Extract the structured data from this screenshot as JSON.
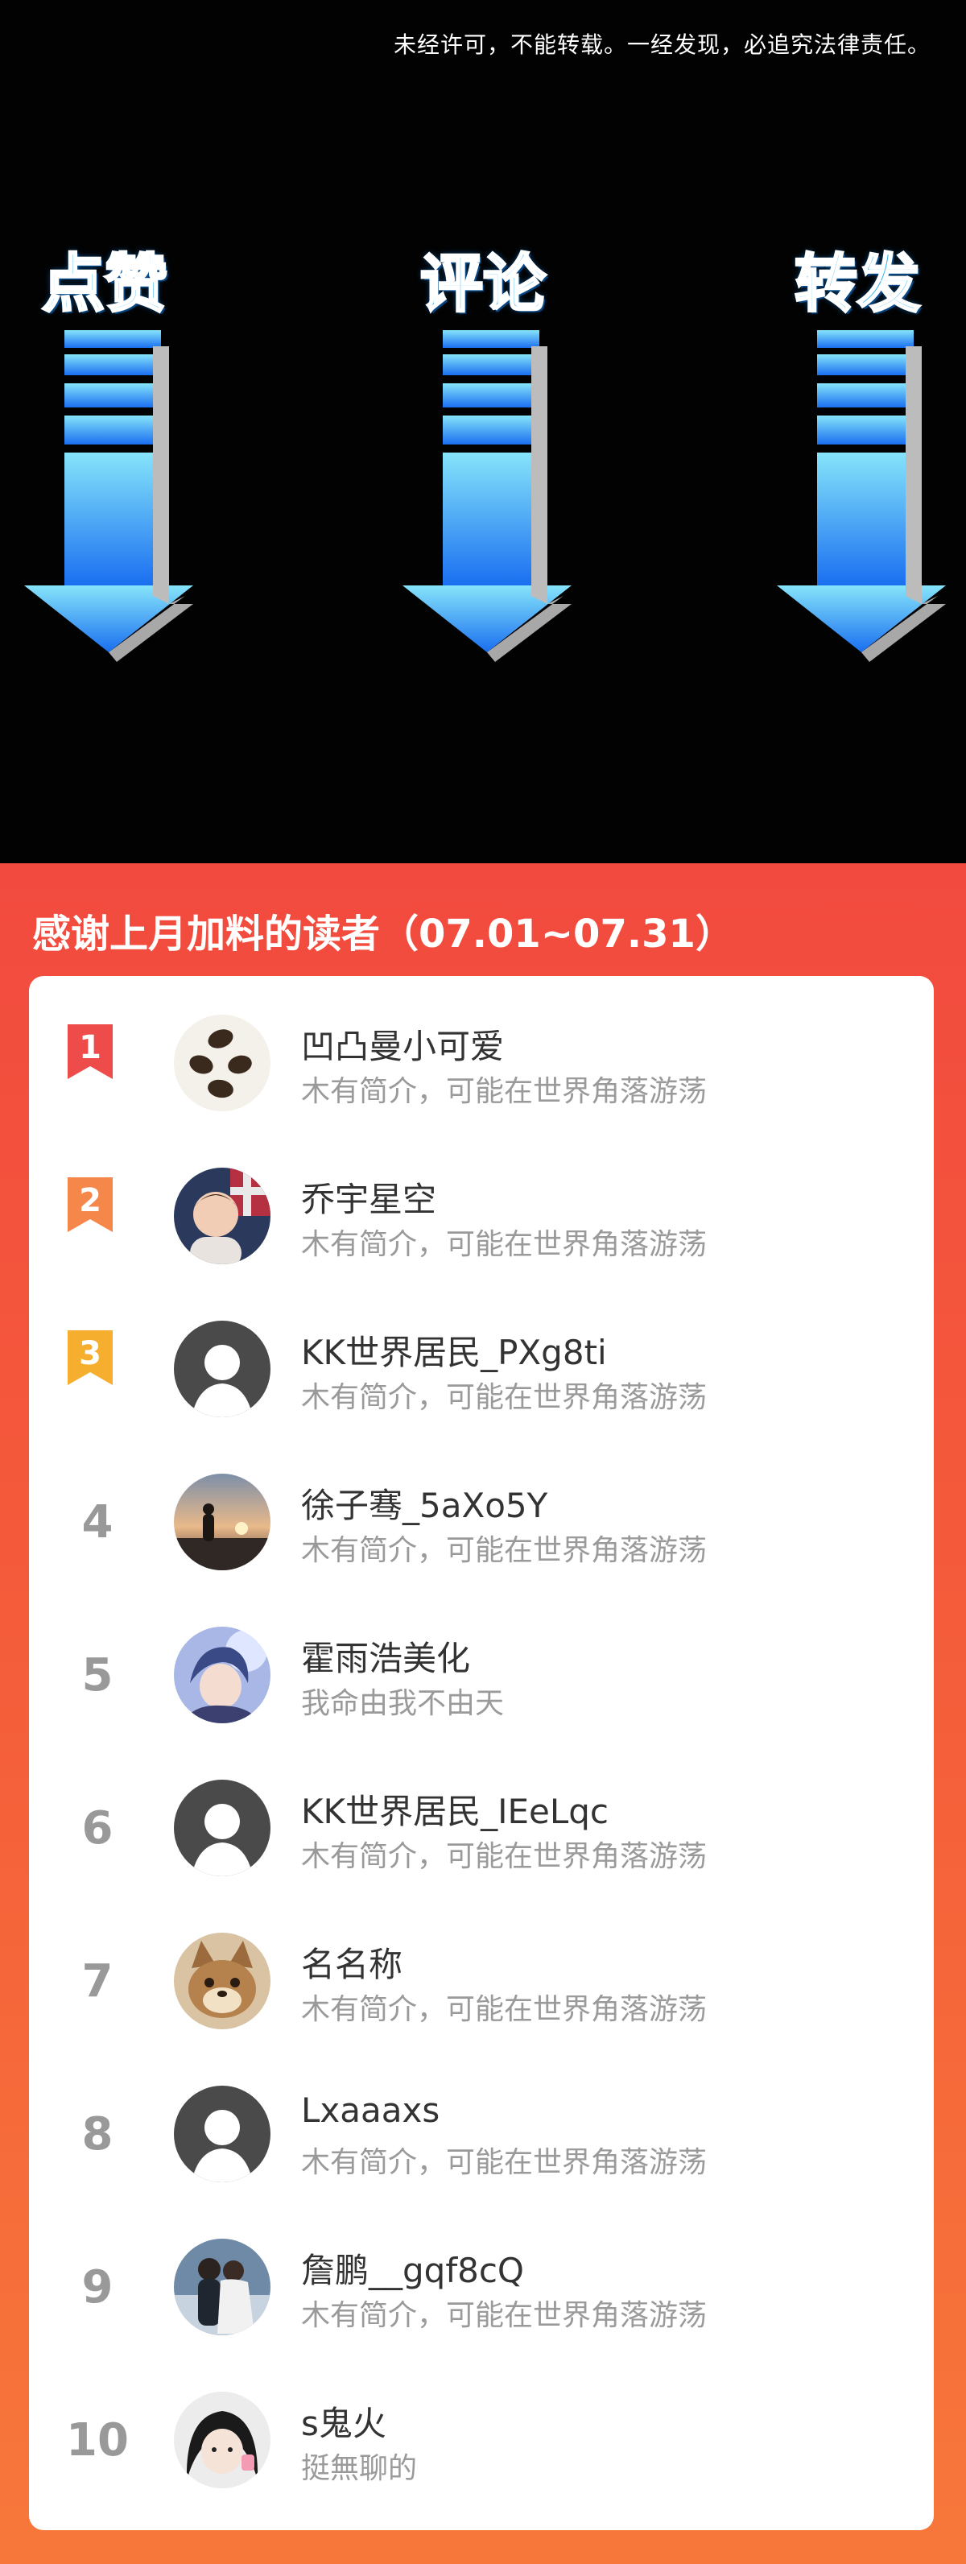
{
  "notice": "未经许可，不能转载。一经发现，必追究法律责任。",
  "actions": [
    {
      "label": "点赞",
      "icon": "down-arrow-icon"
    },
    {
      "label": "评论",
      "icon": "down-arrow-icon"
    },
    {
      "label": "转发",
      "icon": "down-arrow-icon"
    }
  ],
  "panel": {
    "title": "感谢上月加料的读者（07.01~07.31）"
  },
  "colors": {
    "panel_top": "#f24a3f",
    "panel_bottom": "#f7773a",
    "arrow_top": "#86e4fa",
    "arrow_bottom": "#1a6ff0",
    "rank1": "#ee4b4b",
    "rank2": "#f5874b",
    "rank3": "#f6ae2e"
  },
  "readers": [
    {
      "rank": "1",
      "name": "凹凸曼小可爱",
      "desc": "木有简介，可能在世界角落游荡",
      "avatar": "beans-avatar-icon"
    },
    {
      "rank": "2",
      "name": "乔宇星空",
      "desc": "木有简介，可能在世界角落游荡",
      "avatar": "child-photo-avatar-icon"
    },
    {
      "rank": "3",
      "name": "KK世界居民_PXg8ti",
      "desc": "木有简介，可能在世界角落游荡",
      "avatar": "default-user-avatar-icon"
    },
    {
      "rank": "4",
      "name": "徐子骞_5aXo5Y",
      "desc": "木有简介，可能在世界角落游荡",
      "avatar": "sunset-avatar-icon"
    },
    {
      "rank": "5",
      "name": "霍雨浩美化",
      "desc": "我命由我不由天",
      "avatar": "anime-avatar-icon"
    },
    {
      "rank": "6",
      "name": "KK世界居民_IEeLqc",
      "desc": "木有简介，可能在世界角落游荡",
      "avatar": "default-user-avatar-icon"
    },
    {
      "rank": "7",
      "name": "名名称",
      "desc": "木有简介，可能在世界角落游荡",
      "avatar": "cartoon-cat-avatar-icon"
    },
    {
      "rank": "8",
      "name": "Lxaaaxs",
      "desc": "木有简介，可能在世界角落游荡",
      "avatar": "default-user-avatar-icon"
    },
    {
      "rank": "9",
      "name": "詹鹏__gqf8cQ",
      "desc": "木有简介，可能在世界角落游荡",
      "avatar": "couple-avatar-icon"
    },
    {
      "rank": "10",
      "name": "s鬼火",
      "desc": "挺無聊的",
      "avatar": "girl-avatar-icon"
    }
  ]
}
